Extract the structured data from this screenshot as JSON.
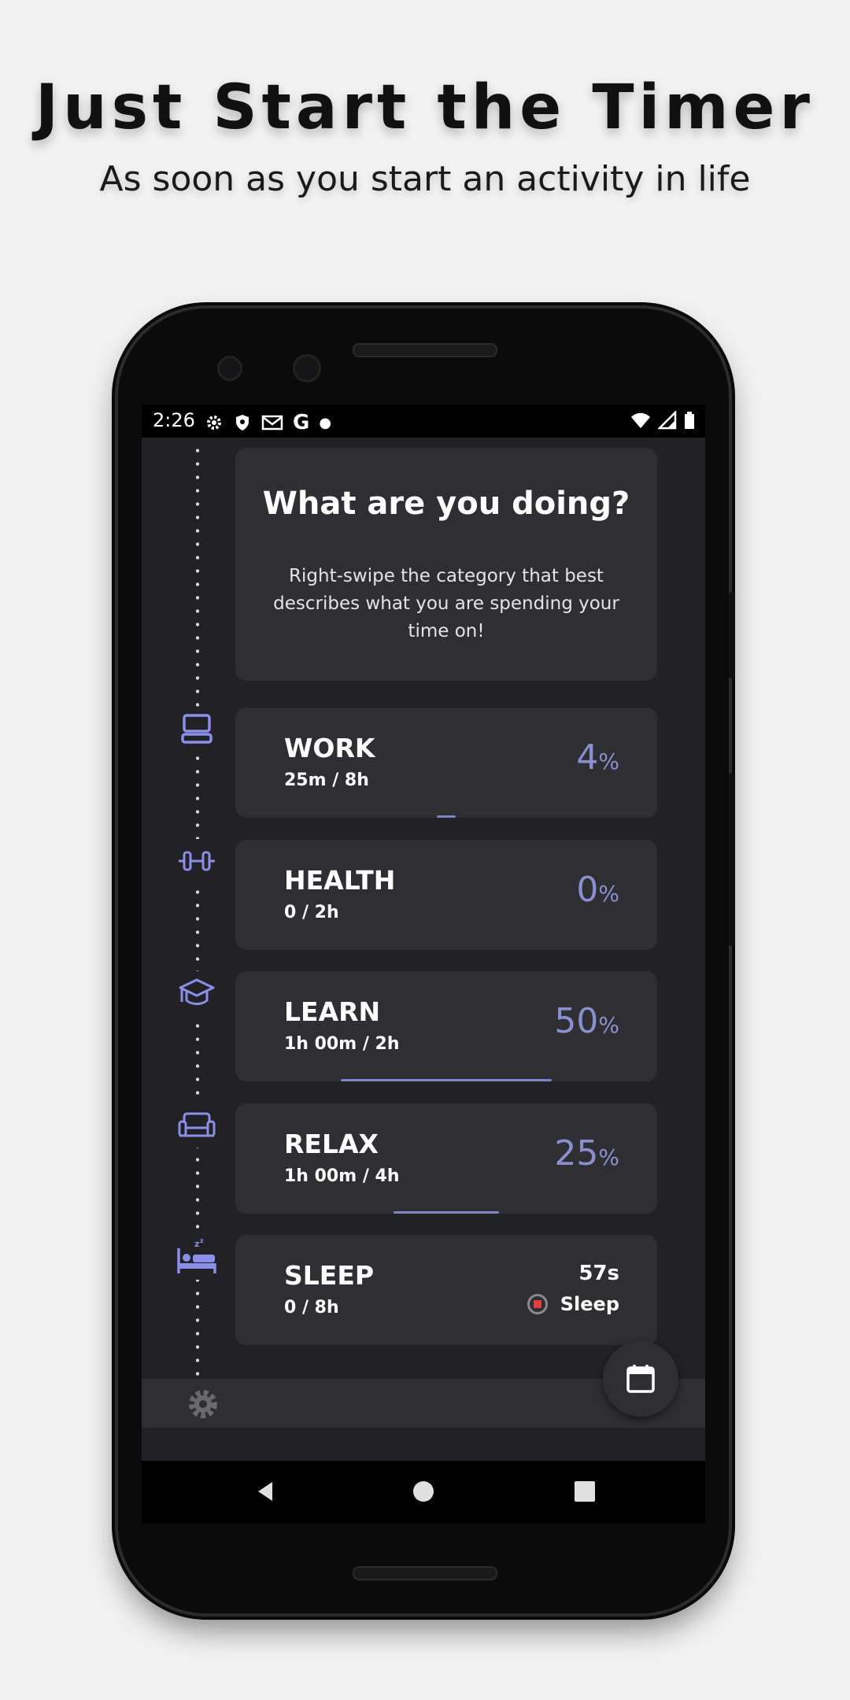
{
  "promo": {
    "title": "Just Start the Timer",
    "subtitle": "As soon as you start an activity in life"
  },
  "status_bar": {
    "time": "2:26",
    "left_icons": [
      "gear-icon",
      "shield-icon",
      "mail-icon",
      "google-icon",
      "dot-icon"
    ],
    "right_icons": [
      "wifi-icon",
      "signal-icon",
      "battery-icon"
    ]
  },
  "intro": {
    "title": "What are you doing?",
    "body": "Right-swipe the category that best describes what you are spending your time on!"
  },
  "categories": [
    {
      "name": "WORK",
      "progress": "25m / 8h",
      "percent": "4",
      "unit": "%",
      "icon": "laptop-icon",
      "fill": 0.04
    },
    {
      "name": "HEALTH",
      "progress": "0 / 2h",
      "percent": "0",
      "unit": "%",
      "icon": "dumbbell-icon",
      "fill": 0.0
    },
    {
      "name": "LEARN",
      "progress": "1h 00m / 2h",
      "percent": "50",
      "unit": "%",
      "icon": "graduation-cap-icon",
      "fill": 0.5
    },
    {
      "name": "RELAX",
      "progress": "1h 00m / 4h",
      "percent": "25",
      "unit": "%",
      "icon": "sofa-icon",
      "fill": 0.25
    },
    {
      "name": "SLEEP",
      "progress": "0 / 8h",
      "timer": "57s",
      "active_label": "Sleep",
      "icon": "bed-icon"
    }
  ],
  "colors": {
    "accent": "#8a8fd0",
    "background": "#212126",
    "card": "#2f2f33",
    "stop": "#e04040"
  },
  "bottom": {
    "settings_icon": "gear-icon",
    "fab_icon": "calendar-icon"
  },
  "nav": [
    "back-icon",
    "home-icon",
    "recents-icon"
  ]
}
